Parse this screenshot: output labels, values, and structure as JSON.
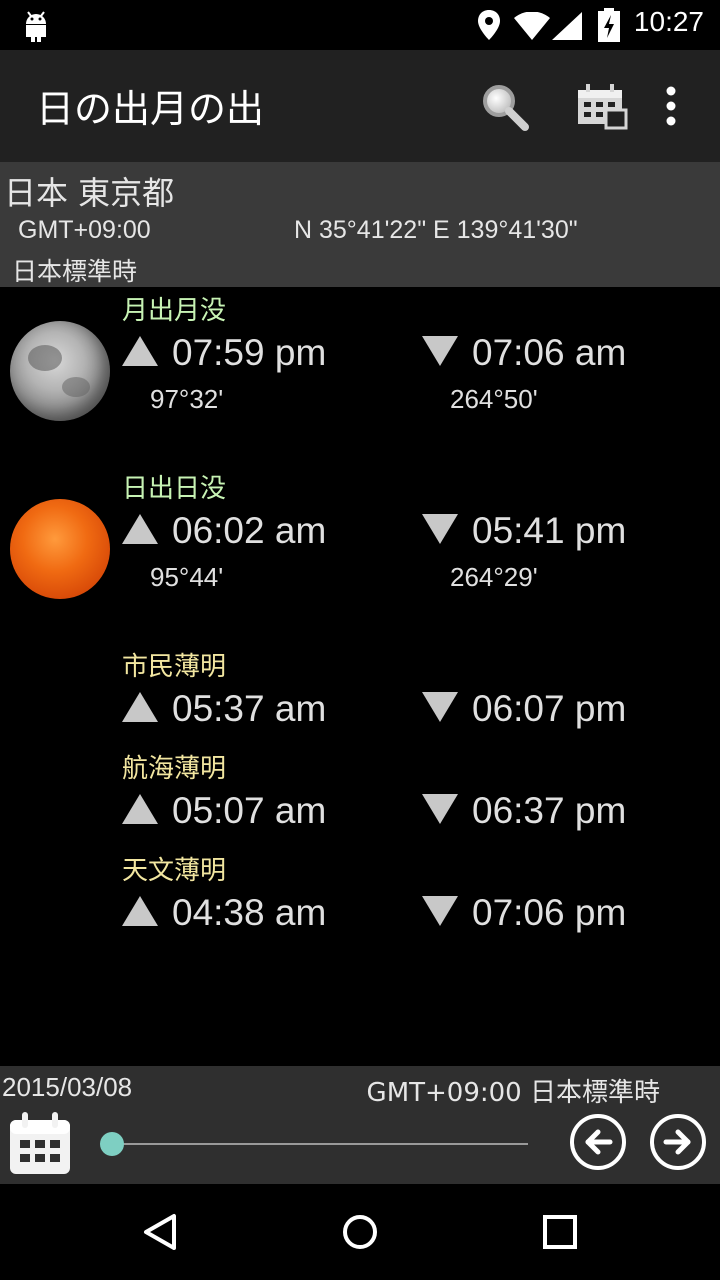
{
  "status_bar": {
    "time": "10:27",
    "icons": [
      "android-icon",
      "location-icon",
      "wifi-icon",
      "signal-icon",
      "battery-charging-icon"
    ]
  },
  "app_bar": {
    "title": "日の出月の出",
    "actions": [
      "search-icon",
      "calendar-grid-icon",
      "overflow-menu-icon"
    ]
  },
  "location": {
    "name": "日本 東京都",
    "gmt": "GMT+09:00",
    "coordinates": "N 35°41'22\" E 139°41'30\"",
    "timezone": "日本標準時"
  },
  "moon": {
    "label": "月出月没",
    "rise": "07:59 pm",
    "set": "07:06 am",
    "rise_azimuth": "97°32'",
    "set_azimuth": "264°50'"
  },
  "sun": {
    "label": "日出日没",
    "rise": "06:02 am",
    "set": "05:41 pm",
    "rise_azimuth": "95°44'",
    "set_azimuth": "264°29'"
  },
  "civil_twilight": {
    "label": "市民薄明",
    "rise": "05:37 am",
    "set": "06:07 pm"
  },
  "nautical_twilight": {
    "label": "航海薄明",
    "rise": "05:07 am",
    "set": "06:37 pm"
  },
  "astronomical_twilight": {
    "label": "天文薄明",
    "rise": "04:38 am",
    "set": "07:06 pm"
  },
  "bottom": {
    "date": "2015/03/08",
    "timezone": "GMT+09:00 日本標準時",
    "slider_value": 0
  },
  "colors": {
    "label_green": "#c7f3b4",
    "label_yellow": "#f2e6a0",
    "slider_thumb": "#7ecfc2",
    "app_bar": "#212121",
    "location_panel": "#3a3a3a"
  }
}
